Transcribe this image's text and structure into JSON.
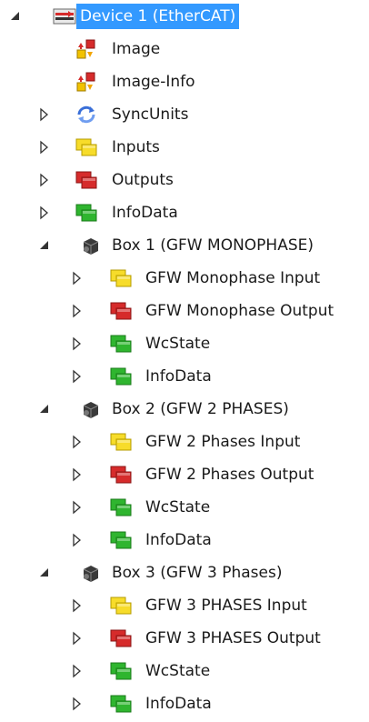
{
  "tree": {
    "device": {
      "label": "Device 1 (EtherCAT)",
      "icon": "ethercat-device-icon",
      "expanded": true,
      "selected": true
    },
    "device_children": [
      {
        "label": "Image",
        "icon": "image-icon",
        "expandable": false
      },
      {
        "label": "Image-Info",
        "icon": "image-info-icon",
        "expandable": false
      },
      {
        "label": "SyncUnits",
        "icon": "sync-units-icon",
        "expandable": true
      },
      {
        "label": "Inputs",
        "icon": "inputs-folder-icon",
        "expandable": true
      },
      {
        "label": "Outputs",
        "icon": "outputs-folder-icon",
        "expandable": true
      },
      {
        "label": "InfoData",
        "icon": "infodata-folder-icon",
        "expandable": true
      }
    ],
    "boxes": [
      {
        "label": "Box 1 (GFW MONOPHASE)",
        "icon": "box-terminal-icon",
        "expanded": true,
        "children": [
          {
            "label": "GFW Monophase Input",
            "icon": "input-folder-icon"
          },
          {
            "label": "GFW Monophase Output",
            "icon": "output-folder-icon"
          },
          {
            "label": "WcState",
            "icon": "wcstate-folder-icon"
          },
          {
            "label": "InfoData",
            "icon": "infodata-folder-icon"
          }
        ]
      },
      {
        "label": "Box 2 (GFW 2 PHASES)",
        "icon": "box-terminal-icon",
        "expanded": true,
        "children": [
          {
            "label": "GFW 2 Phases Input",
            "icon": "input-folder-icon"
          },
          {
            "label": "GFW 2 Phases Output",
            "icon": "output-folder-icon"
          },
          {
            "label": "WcState",
            "icon": "wcstate-folder-icon"
          },
          {
            "label": "InfoData",
            "icon": "infodata-folder-icon"
          }
        ]
      },
      {
        "label": "Box 3 (GFW 3 Phases)",
        "icon": "box-terminal-icon",
        "expanded": true,
        "children": [
          {
            "label": "GFW 3 PHASES Input",
            "icon": "input-folder-icon"
          },
          {
            "label": "GFW 3 PHASES Output",
            "icon": "output-folder-icon"
          },
          {
            "label": "WcState",
            "icon": "wcstate-folder-icon"
          },
          {
            "label": "InfoData",
            "icon": "infodata-folder-icon"
          }
        ]
      }
    ]
  },
  "colors": {
    "selection": "#3399ff",
    "input_yellow": "#f7dc2a",
    "output_red": "#d62b2b",
    "info_green": "#2fb52f",
    "sync_blue": "#3a6fd8"
  }
}
